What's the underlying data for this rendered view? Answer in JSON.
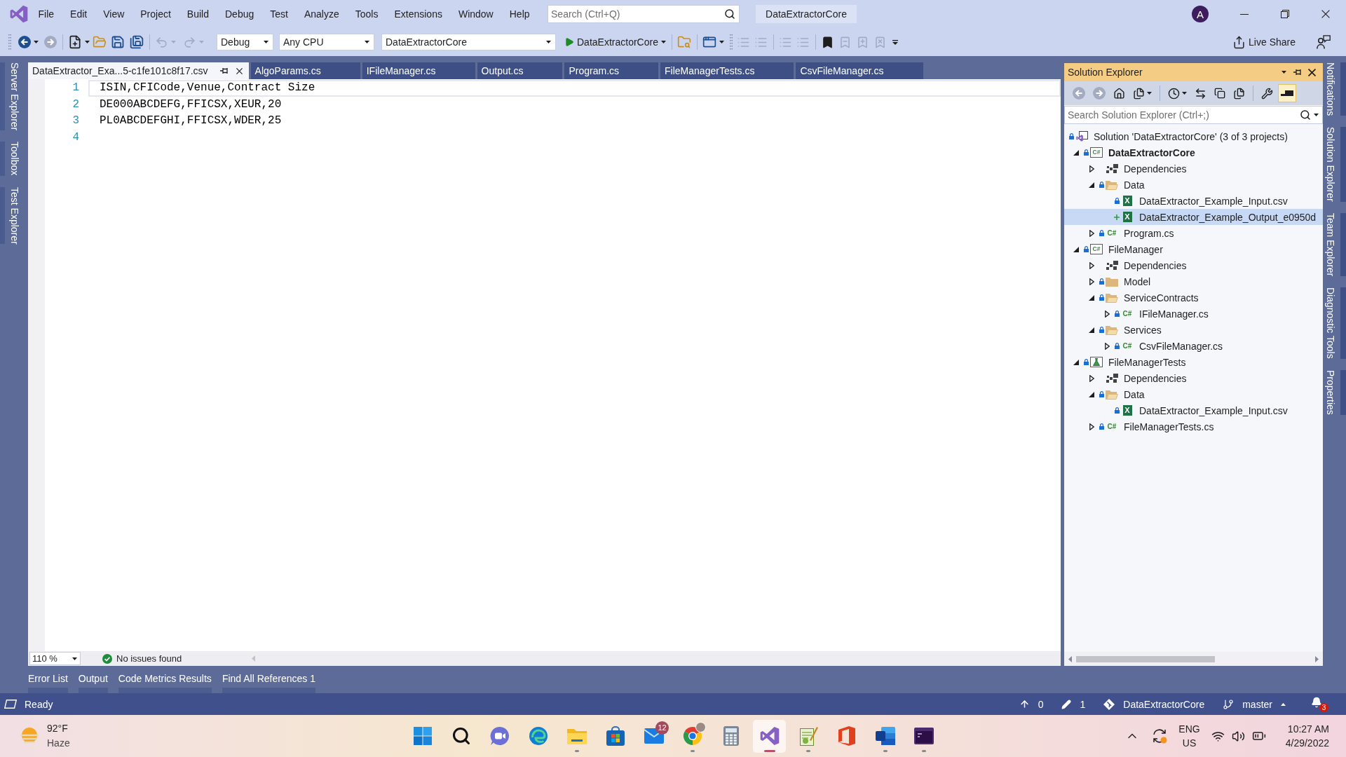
{
  "title_bar": {
    "menu": [
      "File",
      "Edit",
      "View",
      "Project",
      "Build",
      "Debug",
      "Test",
      "Analyze",
      "Tools",
      "Extensions",
      "Window",
      "Help"
    ],
    "search": {
      "placeholder": "Search (Ctrl+Q)"
    },
    "solution_name": "DataExtractorCore",
    "avatar_initial": "A"
  },
  "toolbar": {
    "navigation": [
      {
        "disabled": false
      },
      {
        "disabled": true
      }
    ],
    "history": [
      {
        "disabled": true
      },
      {
        "disabled": true
      }
    ],
    "configuration": "Debug",
    "platform": "Any CPU",
    "startup_project": "DataExtractorCore",
    "start_label": "DataExtractorCore",
    "text_tools": [
      {
        "disabled": true
      },
      {
        "disabled": true
      },
      {
        "disabled": true
      },
      {
        "disabled": true
      }
    ],
    "bookmarks": [
      {
        "disabled": false
      },
      {
        "disabled": true
      },
      {
        "disabled": true
      },
      {
        "disabled": true
      }
    ],
    "live_share": "Live Share"
  },
  "left_tool_tabs": [
    "Server Explorer",
    "Toolbox",
    "Test Explorer"
  ],
  "editor": {
    "tabs": [
      {
        "label": "DataExtractor_Exa...5-c1fe101c8f17.csv",
        "selected": true
      },
      {
        "label": "AlgoParams.cs",
        "selected": false
      },
      {
        "label": "IFileManager.cs",
        "selected": false
      },
      {
        "label": "Output.cs",
        "selected": false
      },
      {
        "label": "Program.cs",
        "selected": false
      },
      {
        "label": "FileManagerTests.cs",
        "selected": false
      },
      {
        "label": "CsvFileManager.cs",
        "selected": false
      }
    ],
    "lines": [
      {
        "number": "1",
        "text": "ISIN,CFICode,Venue,Contract Size",
        "current": true
      },
      {
        "number": "2",
        "text": "DE000ABCDEFG,FFICSX,XEUR,20",
        "current": false
      },
      {
        "number": "3",
        "text": "PL0ABCDEFGHI,FFICSX,WDER,25",
        "current": false
      },
      {
        "number": "4",
        "current": false
      }
    ],
    "zoom": "110 %",
    "issues": "No issues found"
  },
  "solution_explorer": {
    "title": "Solution Explorer",
    "toolbar": [
      {
        "disabled": true,
        "pressed": false
      },
      {
        "disabled": true,
        "pressed": false
      },
      {
        "disabled": false,
        "pressed": false
      },
      {
        "disabled": false,
        "pressed": false
      },
      {
        "disabled": false,
        "pressed": false
      },
      {
        "disabled": false,
        "pressed": false
      },
      {
        "disabled": false,
        "pressed": false
      },
      {
        "disabled": false,
        "pressed": false
      },
      {
        "disabled": false,
        "pressed": false
      },
      {
        "disabled": false,
        "pressed": true
      }
    ],
    "search": {
      "placeholder": "Search Solution Explorer (Ctrl+;)"
    },
    "tree": [
      {
        "label": "Solution 'DataExtractorCore' (3 of 3 projects)",
        "kind": "solution",
        "pending_add": false,
        "selected": false,
        "children": [
          {
            "label": "DataExtractorCore",
            "kind": "project",
            "type_label": "C#",
            "pending_add": false,
            "startup": true,
            "expanded": true,
            "selected": false,
            "children": [
              {
                "label": "Dependencies",
                "kind": "dependencies",
                "expanded": false,
                "selected": false
              },
              {
                "label": "Data",
                "kind": "folder",
                "pending_add": false,
                "expanded": true,
                "selected": false,
                "children": [
                  {
                    "label": "DataExtractor_Example_Input.csv",
                    "kind": "csv",
                    "type_label": "X",
                    "pending_add": false,
                    "selected": false
                  },
                  {
                    "label": "DataExtractor_Example_Output_e0950d",
                    "kind": "csv",
                    "type_label": "X",
                    "pending_add": true,
                    "selected": true
                  }
                ]
              },
              {
                "label": "Program.cs",
                "kind": "csharp",
                "type_label": "C#",
                "pending_add": false,
                "expanded": false,
                "selected": false
              }
            ]
          },
          {
            "label": "FileManager",
            "kind": "project",
            "type_label": "C#",
            "pending_add": false,
            "startup": false,
            "expanded": true,
            "selected": false,
            "children": [
              {
                "label": "Dependencies",
                "kind": "dependencies",
                "expanded": false,
                "selected": false
              },
              {
                "label": "Model",
                "kind": "folder",
                "pending_add": false,
                "expanded": false,
                "selected": false
              },
              {
                "label": "ServiceContracts",
                "kind": "folder",
                "pending_add": false,
                "expanded": true,
                "selected": false,
                "children": [
                  {
                    "label": "IFileManager.cs",
                    "kind": "csharp",
                    "type_label": "C#",
                    "pending_add": false,
                    "expanded": false,
                    "selected": false
                  }
                ]
              },
              {
                "label": "Services",
                "kind": "folder",
                "pending_add": false,
                "expanded": true,
                "selected": false,
                "children": [
                  {
                    "label": "CsvFileManager.cs",
                    "kind": "csharp",
                    "type_label": "C#",
                    "pending_add": false,
                    "expanded": false,
                    "selected": false
                  }
                ]
              }
            ]
          },
          {
            "label": "FileManagerTests",
            "kind": "test-project",
            "pending_add": false,
            "startup": false,
            "expanded": true,
            "selected": false,
            "children": [
              {
                "label": "Dependencies",
                "kind": "dependencies",
                "expanded": false,
                "selected": false
              },
              {
                "label": "Data",
                "kind": "folder",
                "pending_add": false,
                "expanded": true,
                "selected": false,
                "children": [
                  {
                    "label": "DataExtractor_Example_Input.csv",
                    "kind": "csv",
                    "type_label": "X",
                    "pending_add": false,
                    "selected": false
                  }
                ]
              },
              {
                "label": "FileManagerTests.cs",
                "kind": "csharp",
                "type_label": "C#",
                "pending_add": false,
                "expanded": false,
                "selected": false
              }
            ]
          }
        ]
      }
    ]
  },
  "right_tool_tabs": [
    "Notifications",
    "Solution Explorer",
    "Team Explorer",
    "Diagnostic Tools",
    "Properties"
  ],
  "bottom_tool_tabs": [
    "Error List",
    "Output",
    "Code Metrics Results",
    "Find All References 1"
  ],
  "status_bar": {
    "state": "Ready",
    "outgoing_commits": "0",
    "pending_changes": "1",
    "repository": "DataExtractorCore",
    "branch": "master",
    "notifications": "3"
  },
  "taskbar": {
    "weather": {
      "temperature": "92°F",
      "condition": "Haze"
    },
    "apps": [
      {
        "running": false,
        "active": false
      },
      {
        "running": false,
        "active": false
      },
      {
        "running": false,
        "active": false
      },
      {
        "running": false,
        "active": false
      },
      {
        "running": true,
        "active": false
      },
      {
        "running": false,
        "active": false
      },
      {
        "running": false,
        "active": false,
        "badge": "12"
      },
      {
        "running": true,
        "active": false
      },
      {
        "running": false,
        "active": false
      },
      {
        "running": true,
        "active": true
      },
      {
        "running": true,
        "active": false
      },
      {
        "running": false,
        "active": false
      },
      {
        "running": true,
        "active": false
      },
      {
        "running": true,
        "active": false
      }
    ],
    "input": {
      "language": "ENG",
      "region": "US"
    },
    "clock": {
      "time": "10:27 AM",
      "date": "4/29/2022"
    }
  }
}
